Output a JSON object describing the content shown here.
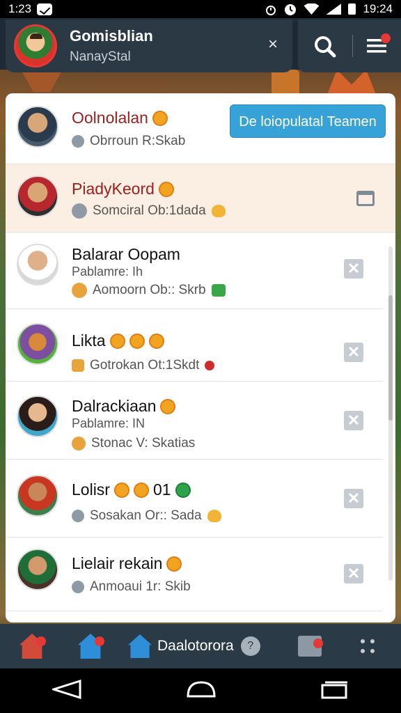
{
  "status_bar": {
    "time_left": "1:23",
    "time_right": "19:24"
  },
  "header": {
    "title": "Gomisblian",
    "subtitle": "NanayStal",
    "close_icon": "×"
  },
  "list": {
    "cta_label": "De loiopulatal Teamen",
    "rows": [
      {
        "name": "Oolnolalan",
        "line": "Obrroun R:Skab",
        "highlighted": false
      },
      {
        "name": "PiadyKeord",
        "line": "Somciral Ob:1dada",
        "highlighted": true
      },
      {
        "name": "Balarar Oopam",
        "sub": "Pablamre: Ih",
        "line": "Aomoorn Ob:: Skrb"
      },
      {
        "name": "Likta",
        "line": "Gotrokan Ot:1Skdt"
      },
      {
        "name": "Dalrackiaan",
        "sub": "Pablamre: IN",
        "line": "Stonac  V: Skatias"
      },
      {
        "name": "Lolisr",
        "badge_text": "01",
        "line": "Sosakan Or:: Sada"
      },
      {
        "name": "Lielair rekain",
        "line": "Anmoaui 1r: Skib"
      }
    ]
  },
  "gamebar": {
    "label": "Daalotorora",
    "help": "?"
  },
  "colors": {
    "header_bg": "#2b3945",
    "cta": "#37a2d8",
    "highlight_row": "#fbeee2",
    "badge": "#e53935"
  }
}
